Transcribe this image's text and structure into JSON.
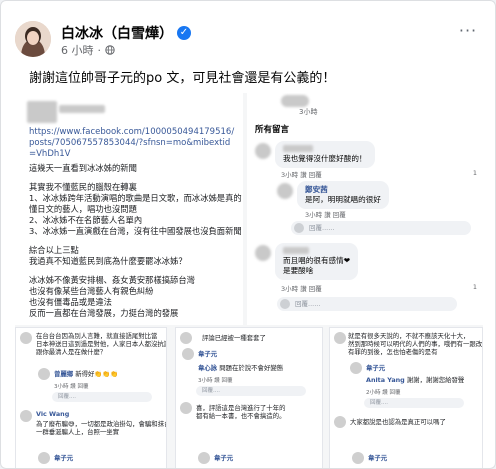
{
  "post": {
    "author": "白冰冰（白雪燁）",
    "time": "6 小時",
    "privacy_sep": "·",
    "more": "···",
    "caption": "謝謝這位帥哥子元的po 文，可見社會還是有公義的！"
  },
  "shared_doc": {
    "link": "https://www.facebook.com/100005049417951​6/posts/705067557853044/?sfnsn=mo&mibextid=VhDh1V",
    "lines": [
      "這幾天一直看到冰冰姊的新聞",
      "",
      "其實我不懂藍民的腦殼在轉裏",
      "1、冰冰姊跨年活動演唱的歌曲是日文歌，而冰冰姊是真的",
      "懂日文的藝人，唱功也沒問題",
      "2、冰冰姊不在名節藝人名單內",
      "3、冰冰姊一直演戲在台灣，沒有往中國發展也沒負面新聞",
      "",
      "綜合以上三點",
      "我過真不知道藍民到底為什麼要罷冰冰姊？",
      "",
      "冰冰姊不像黃安排楊、姦女黃安那樣搞舔台灣",
      "也沒有像某些台灣藝人有親色糾紛",
      "也沒有僵毒品或是違法",
      "反而一直都在台灣發展，力挺台灣的發展"
    ]
  },
  "comments_panel": {
    "time": "3小時",
    "heading": "所有留言",
    "items": [
      {
        "author": "",
        "text": "我也覺得沒什麼好酸的！",
        "meta": "3小時   讚   回覆",
        "count": "1"
      },
      {
        "author": "鄭安茜",
        "text": "是阿，明明就唱的很好",
        "meta": "3小時   讚   回覆",
        "count": ""
      },
      {
        "author": "",
        "text": "而且唱的很有感情❤",
        "text2": "是要酸啥",
        "meta": "3小時   讚   回覆",
        "count": "1"
      }
    ],
    "reply_placeholder": "回覆......"
  },
  "bottom_panels": {
    "p1": {
      "lines": [
        "在台台台因為別人言難，就直接語尾對比當",
        "日本神送日這到過是對他，人家日本人都沒抗議",
        "跟你最清人是在做什麼？"
      ],
      "reply_name": "曾麗鄉",
      "reply_text": "新得好👏👏👏",
      "meta": "3小時   讚   回覆",
      "box": "回覆....",
      "user2": "Vic Wang",
      "user2_text": "為了廢布騙😅，一切都是政治掛勾，會騙和抹台",
      "user2_text2": "一群垂涎騙人上，台照一坐實",
      "user3": "韋子元"
    },
    "p2": {
      "lines": [
        "評論已經被一種套套了"
      ],
      "user": "韋子元",
      "reply_name": "韋心詠",
      "reply_text": "問題在於說不會好變態",
      "meta": "3小時   讚   回覆",
      "box": "回覆....",
      "line2": "喜，評語這是台灣進行了十年的",
      "line3": "都有給一本書，也不會搞造的。",
      "user2": "韋子元"
    },
    "p3": {
      "lines": [
        "就是有很多天說的，不就不應該天化十大，",
        "然到那時候可以明代的人們的事，哦們有一跟改為沒有",
        "有罪的到後，怎也怕老傷的是有"
      ],
      "user": "韋子元",
      "reply_name": "Anita Yang",
      "reply_text": "謝謝，謝謝您給發聲",
      "meta": "2小時   讚   回覆",
      "box": "回覆....",
      "line2": "大家都說是也認為是真正可以嗎了",
      "user2": "韋子元"
    }
  },
  "colors": {
    "link": "#385898",
    "verified": "#1877f2",
    "heart": "#e0245e"
  }
}
